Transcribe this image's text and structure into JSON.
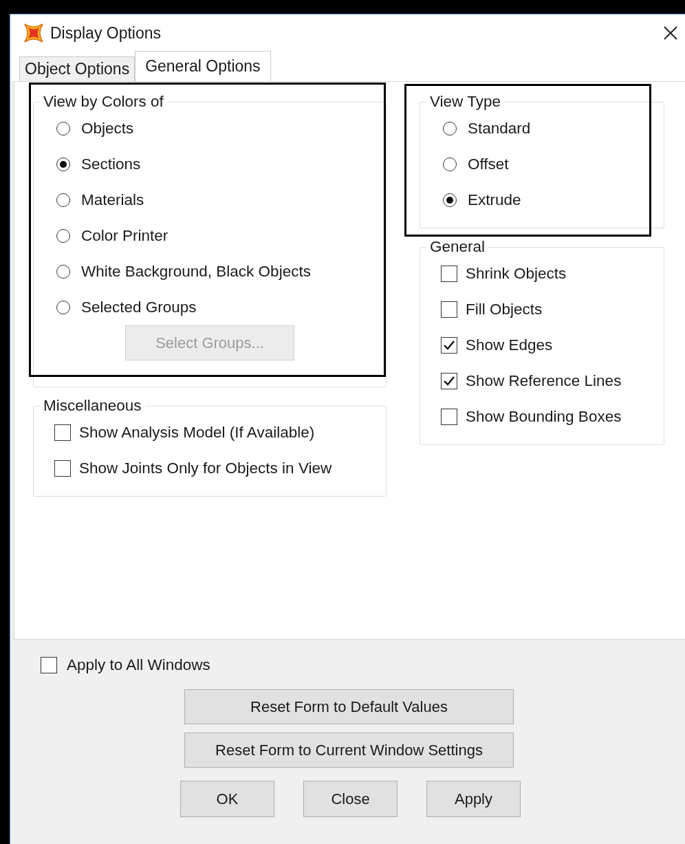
{
  "window": {
    "title": "Display Options"
  },
  "tabs": [
    {
      "label": "Object Options",
      "selected": false
    },
    {
      "label": "General Options",
      "selected": true
    }
  ],
  "view_by_colors": {
    "title": "View by Colors of",
    "options": [
      {
        "label": "Objects",
        "selected": false
      },
      {
        "label": "Sections",
        "selected": true
      },
      {
        "label": "Materials",
        "selected": false
      },
      {
        "label": "Color Printer",
        "selected": false
      },
      {
        "label": "White Background, Black Objects",
        "selected": false
      },
      {
        "label": "Selected Groups",
        "selected": false
      }
    ],
    "button": {
      "label": "Select Groups...",
      "disabled": true
    }
  },
  "miscellaneous": {
    "title": "Miscellaneous",
    "items": [
      {
        "label": "Show Analysis Model (If Available)",
        "checked": false
      },
      {
        "label": "Show Joints Only for Objects in View",
        "checked": false
      }
    ]
  },
  "view_type": {
    "title": "View Type",
    "options": [
      {
        "label": "Standard",
        "selected": false
      },
      {
        "label": "Offset",
        "selected": false
      },
      {
        "label": "Extrude",
        "selected": true
      }
    ]
  },
  "general": {
    "title": "General",
    "items": [
      {
        "label": "Shrink Objects",
        "checked": false
      },
      {
        "label": "Fill Objects",
        "checked": false
      },
      {
        "label": "Show Edges",
        "checked": true
      },
      {
        "label": "Show Reference Lines",
        "checked": true
      },
      {
        "label": "Show Bounding Boxes",
        "checked": false
      }
    ]
  },
  "apply_all": {
    "label": "Apply to All Windows",
    "checked": false
  },
  "reset_buttons": [
    "Reset Form to Default Values",
    "Reset Form to Current Window Settings"
  ],
  "buttons": [
    "OK",
    "Close",
    "Apply"
  ]
}
